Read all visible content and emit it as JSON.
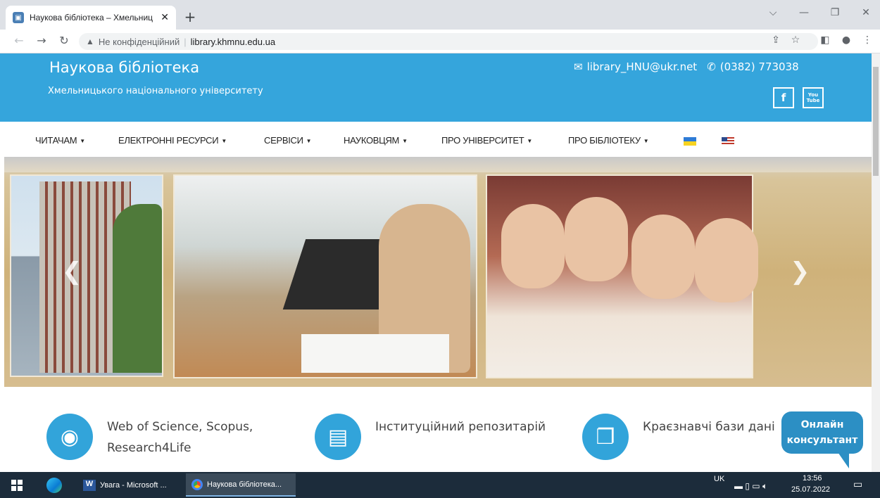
{
  "browser": {
    "tab_title": "Наукова бібліотека – Хмельниц",
    "tab_close": "✕",
    "new_tab": "+",
    "security_label": "Не конфіденційний",
    "url": "library.khmnu.edu.ua"
  },
  "site": {
    "title": "Наукова бібліотека",
    "subtitle": "Хмельницького національного університету",
    "email": "library_HNU@ukr.net",
    "phone": "(0382) 773038",
    "social": [
      "f",
      "You Tube"
    ]
  },
  "nav": {
    "items": [
      {
        "label": "ЧИТАЧАМ"
      },
      {
        "label": "ЕЛЕКТРОННІ РЕСУРСИ"
      },
      {
        "label": "СЕРВІСИ"
      },
      {
        "label": "НАУКОВЦЯМ"
      },
      {
        "label": "ПРО УНІВЕРСИТЕТ"
      },
      {
        "label": "ПРО БІБЛІОТЕКУ"
      }
    ]
  },
  "features": [
    {
      "label_line1": "Web of Science, Scopus,",
      "label_line2": "Research4Life",
      "icon": "globe-icon"
    },
    {
      "label_line1": "Інституційний репозитарій",
      "label_line2": "",
      "icon": "book-icon"
    },
    {
      "label_line1": "Краєзнавчі бази дані",
      "label_line2": "",
      "icon": "copy-icon"
    }
  ],
  "consult": {
    "line1": "Онлайн",
    "line2": "консультант"
  },
  "taskbar": {
    "apps": [
      {
        "label": "Увага - Microsoft ..."
      },
      {
        "label": "Наукова бібліотека..."
      }
    ],
    "lang": "UK",
    "time": "13:56",
    "date": "25.07.2022"
  },
  "colors": {
    "header": "#35a5dc",
    "accent": "#32a4da",
    "taskbar": "#1c2c3b"
  }
}
